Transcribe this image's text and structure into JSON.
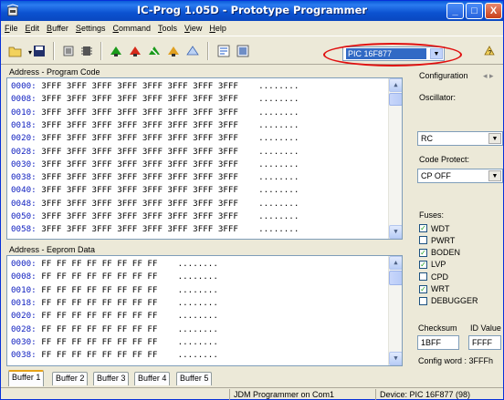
{
  "window": {
    "title": "IC-Prog 1.05D - Prototype Programmer"
  },
  "title_buttons": {
    "minimize": "_",
    "maximize": "□",
    "close": "X"
  },
  "menu": [
    "File",
    "Edit",
    "Buffer",
    "Settings",
    "Command",
    "Tools",
    "View",
    "Help"
  ],
  "toolbar": {
    "icons": [
      "open-icon",
      "save-icon",
      "config-icon",
      "chip-icon",
      "read-device-icon",
      "program-device-icon",
      "erase-device-icon",
      "verify-device-icon",
      "blank-check-icon",
      "assembler-view-icon",
      "hex-view-icon",
      "help-icon"
    ],
    "device": "PIC 16F877"
  },
  "program_code": {
    "label": "Address - Program Code",
    "rows": [
      {
        "addr": "0000:",
        "words": "3FFF 3FFF 3FFF 3FFF 3FFF 3FFF 3FFF 3FFF",
        "ascii": "........"
      },
      {
        "addr": "0008:",
        "words": "3FFF 3FFF 3FFF 3FFF 3FFF 3FFF 3FFF 3FFF",
        "ascii": "........"
      },
      {
        "addr": "0010:",
        "words": "3FFF 3FFF 3FFF 3FFF 3FFF 3FFF 3FFF 3FFF",
        "ascii": "........"
      },
      {
        "addr": "0018:",
        "words": "3FFF 3FFF 3FFF 3FFF 3FFF 3FFF 3FFF 3FFF",
        "ascii": "........"
      },
      {
        "addr": "0020:",
        "words": "3FFF 3FFF 3FFF 3FFF 3FFF 3FFF 3FFF 3FFF",
        "ascii": "........"
      },
      {
        "addr": "0028:",
        "words": "3FFF 3FFF 3FFF 3FFF 3FFF 3FFF 3FFF 3FFF",
        "ascii": "........"
      },
      {
        "addr": "0030:",
        "words": "3FFF 3FFF 3FFF 3FFF 3FFF 3FFF 3FFF 3FFF",
        "ascii": "........"
      },
      {
        "addr": "0038:",
        "words": "3FFF 3FFF 3FFF 3FFF 3FFF 3FFF 3FFF 3FFF",
        "ascii": "........"
      },
      {
        "addr": "0040:",
        "words": "3FFF 3FFF 3FFF 3FFF 3FFF 3FFF 3FFF 3FFF",
        "ascii": "........"
      },
      {
        "addr": "0048:",
        "words": "3FFF 3FFF 3FFF 3FFF 3FFF 3FFF 3FFF 3FFF",
        "ascii": "........"
      },
      {
        "addr": "0050:",
        "words": "3FFF 3FFF 3FFF 3FFF 3FFF 3FFF 3FFF 3FFF",
        "ascii": "........"
      },
      {
        "addr": "0058:",
        "words": "3FFF 3FFF 3FFF 3FFF 3FFF 3FFF 3FFF 3FFF",
        "ascii": "........"
      }
    ]
  },
  "eeprom": {
    "label": "Address - Eeprom Data",
    "rows": [
      {
        "addr": "0000:",
        "bytes": "FF FF FF FF FF FF FF FF",
        "ascii": "........"
      },
      {
        "addr": "0008:",
        "bytes": "FF FF FF FF FF FF FF FF",
        "ascii": "........"
      },
      {
        "addr": "0010:",
        "bytes": "FF FF FF FF FF FF FF FF",
        "ascii": "........"
      },
      {
        "addr": "0018:",
        "bytes": "FF FF FF FF FF FF FF FF",
        "ascii": "........"
      },
      {
        "addr": "0020:",
        "bytes": "FF FF FF FF FF FF FF FF",
        "ascii": "........"
      },
      {
        "addr": "0028:",
        "bytes": "FF FF FF FF FF FF FF FF",
        "ascii": "........"
      },
      {
        "addr": "0030:",
        "bytes": "FF FF FF FF FF FF FF FF",
        "ascii": "........"
      },
      {
        "addr": "0038:",
        "bytes": "FF FF FF FF FF FF FF FF",
        "ascii": "........"
      }
    ]
  },
  "config": {
    "header": "Configuration",
    "nav_arrows": "◂ ▸",
    "oscillator_label": "Oscillator:",
    "oscillator_value": "RC",
    "code_protect_label": "Code Protect:",
    "code_protect_value": "CP OFF",
    "fuses_label": "Fuses:",
    "fuses": [
      {
        "name": "WDT",
        "checked": true
      },
      {
        "name": "PWRT",
        "checked": false
      },
      {
        "name": "BODEN",
        "checked": true
      },
      {
        "name": "LVP",
        "checked": true
      },
      {
        "name": "CPD",
        "checked": false
      },
      {
        "name": "WRT",
        "checked": true
      },
      {
        "name": "DEBUGGER",
        "checked": false
      }
    ],
    "checksum_label": "Checksum",
    "checksum_value": "1BFF",
    "id_label": "ID Value",
    "id_value": "FFFF",
    "config_word": "Config word : 3FFFh"
  },
  "tabs": [
    "Buffer 1",
    "Buffer 2",
    "Buffer 3",
    "Buffer 4",
    "Buffer 5"
  ],
  "status": {
    "programmer": "JDM Programmer on Com1",
    "device": "Device: PIC 16F877   (98)"
  },
  "colors": {
    "title_bar": "#0a5ad8",
    "address_text": "#1020c0",
    "selection": "#316ac5",
    "highlight_ring": "#e01010"
  }
}
